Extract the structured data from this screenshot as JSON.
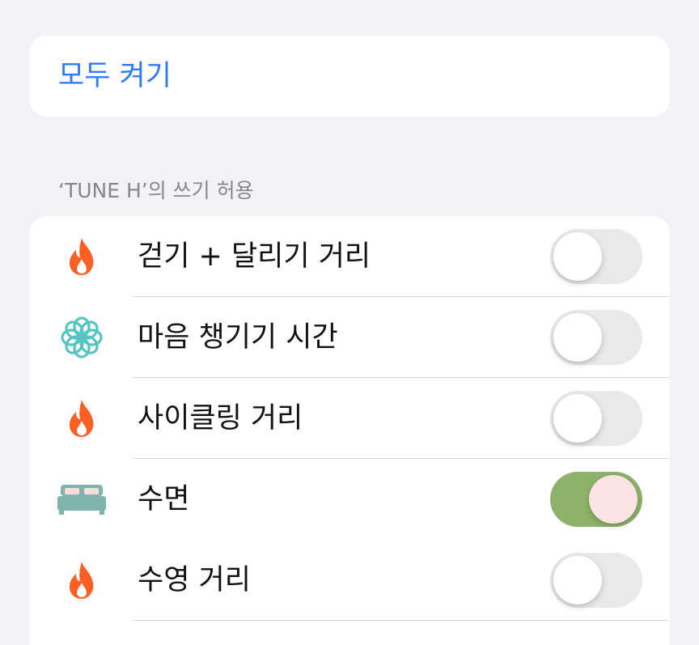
{
  "top_card": {
    "turn_on_all_label": "모두 켜기"
  },
  "section": {
    "header": "‘TUNE H’의 쓰기 허용"
  },
  "items": [
    {
      "label": "걷기 + 달리기 거리",
      "icon": "flame-icon",
      "icon_color": "#fe5f25",
      "enabled": false
    },
    {
      "label": "마음 챙기기 시간",
      "icon": "mindfulness-flower-icon",
      "icon_color": "#56c4c0",
      "enabled": false
    },
    {
      "label": "사이클링 거리",
      "icon": "flame-icon",
      "icon_color": "#fe5f25",
      "enabled": false
    },
    {
      "label": "수면",
      "icon": "bed-icon",
      "icon_color": "#7fb3ad",
      "enabled": true,
      "highlighted": true
    },
    {
      "label": "수영 거리",
      "icon": "flame-icon",
      "icon_color": "#fe5f25",
      "enabled": false
    }
  ],
  "colors": {
    "link_blue": "#2f7cf6",
    "toggle_on": "#8db26a",
    "toggle_off": "#e9e9ea",
    "highlight_fill": "#fedcdc",
    "highlight_border": "#d2341f"
  }
}
